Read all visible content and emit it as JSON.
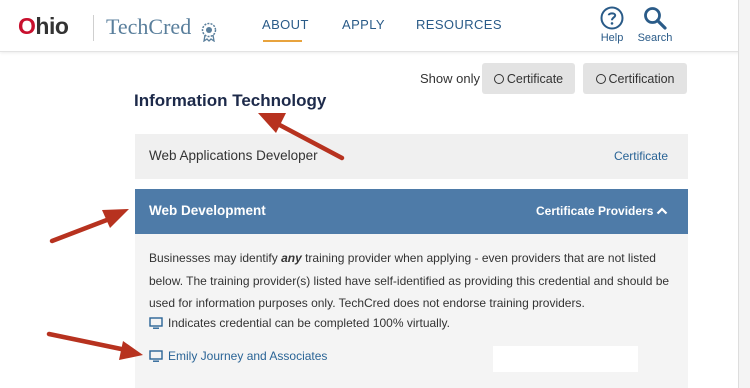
{
  "header": {
    "logo_ohio_first": "O",
    "logo_ohio_rest": "hio",
    "logo_techcred": "TechCred",
    "nav": [
      {
        "label": "ABOUT"
      },
      {
        "label": "APPLY"
      },
      {
        "label": "RESOURCES"
      }
    ],
    "help_label": "Help",
    "search_label": "Search",
    "accent_color": "#e8a33d",
    "link_color": "#2a5b88"
  },
  "filters": {
    "show_only_label": "Show only",
    "options": [
      {
        "label": "Certificate"
      },
      {
        "label": "Certification"
      }
    ]
  },
  "page_title": "Information Technology",
  "credentials": [
    {
      "name": "Web Applications Developer",
      "type": "Certificate",
      "expanded": false
    },
    {
      "name": "Web Development",
      "type": "Certificate Providers",
      "expanded": true
    }
  ],
  "panel": {
    "text_before_em": "Businesses may identify ",
    "text_em": "any",
    "text_after_em": " training provider when applying - even providers that are not listed below. The training provider(s) listed have self-identified as providing this credential and should be used for information purposes only. TechCred does not endorse training providers.",
    "virtual_note": "Indicates credential can be completed 100% virtually.",
    "providers": [
      {
        "name": "Emily Journey and Associates",
        "virtual": true
      }
    ]
  },
  "colors": {
    "expanded_row_bg": "#4e7ba8",
    "annotation_arrow": "#b7321f"
  }
}
